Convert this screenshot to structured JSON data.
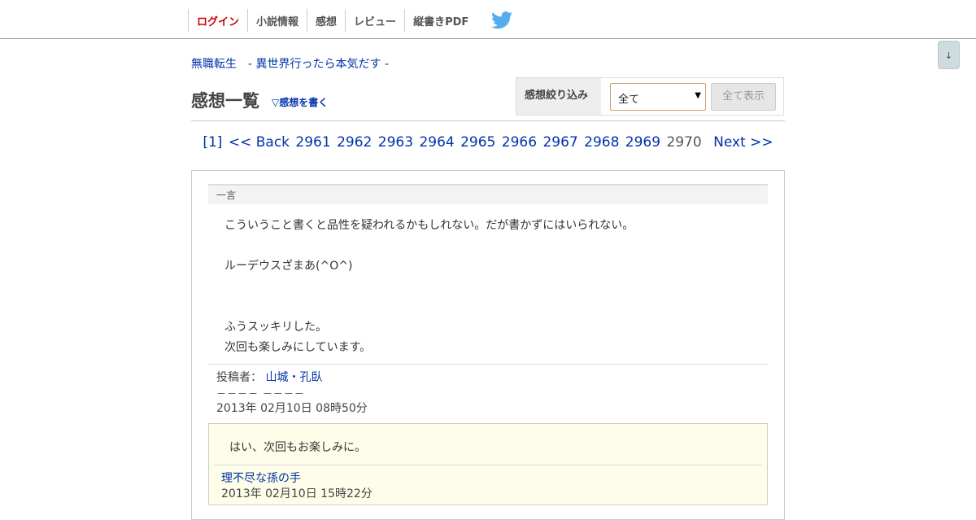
{
  "nav": {
    "login": "ログイン",
    "novel_info": "小説情報",
    "impressions": "感想",
    "review": "レビュー",
    "vertical_pdf": "縦書きPDF"
  },
  "scroll_button": "↓",
  "novel_title": "無職転生　- 異世界行ったら本気だす -",
  "page_heading": "感想一覧",
  "write_link": "▽感想を書く",
  "filter": {
    "label": "感想絞り込み",
    "selected": "全て",
    "show_all": "全て表示"
  },
  "pager": {
    "first": "[1]",
    "back": "<< Back",
    "pages": [
      "2961",
      "2962",
      "2963",
      "2964",
      "2965",
      "2966",
      "2967",
      "2968",
      "2969"
    ],
    "current": "2970",
    "next": "Next >>"
  },
  "comment": {
    "section_label": "一言",
    "lines": [
      "こういうこと書くと品性を疑われるかもしれない。だが書かずにはいられない。",
      "ルーデウスざまあ(^O^)",
      "ふうスッキリした。",
      "次回も楽しみにしています。"
    ],
    "poster_label": "投稿者：",
    "poster_name": "山城・孔臥",
    "poster_dashes": "－－－－ －－－－",
    "date": "2013年 02月10日 08時50分",
    "reply": {
      "text": "はい、次回もお楽しみに。",
      "author": "理不尽な孫の手",
      "date": "2013年 02月10日 15時22分"
    }
  },
  "colors": {
    "link": "#0033aa",
    "login": "#cc0000",
    "twitter": "#55acee",
    "reply_bg": "#fdfde9"
  }
}
